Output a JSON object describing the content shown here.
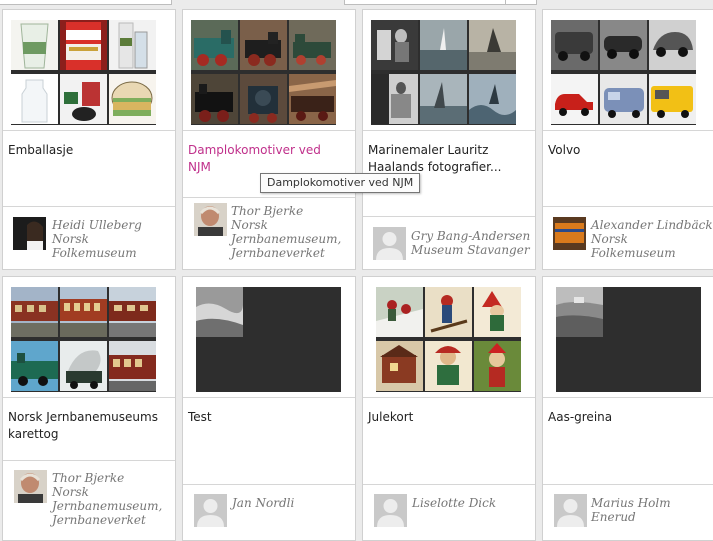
{
  "cards": [
    {
      "title": "Emballasje",
      "author_lines": [
        "Heidi Ulleberg",
        "Norsk",
        "Folkemuseum"
      ],
      "avatar": "person-dark-avatar",
      "title_is_link": false
    },
    {
      "title": "Damplokomotiver ved NJM",
      "author_lines": [
        "Thor Bjerke",
        "Norsk",
        "Jernbanemuseum,",
        "Jernbaneverket"
      ],
      "avatar": "person-portrait-avatar",
      "title_is_link": true
    },
    {
      "title": "Marinemaler Lauritz Haalands fotografier...",
      "author_lines": [
        "Gry Bang-Andersen",
        "Museum Stavanger"
      ],
      "avatar": "default-user-avatar",
      "title_is_link": false
    },
    {
      "title": "Volvo",
      "author_lines": [
        "Alexander Lindbäck",
        "Norsk",
        "Folkemuseum"
      ],
      "avatar": "orange-object-avatar",
      "title_is_link": false
    },
    {
      "title": "Norsk Jernbanemuseums karettog",
      "author_lines": [
        "Thor Bjerke",
        "Norsk",
        "Jernbanemuseum,",
        "Jernbaneverket"
      ],
      "avatar": "person-portrait-avatar",
      "title_is_link": false
    },
    {
      "title": "Test",
      "author_lines": [
        "Jan Nordli"
      ],
      "avatar": "default-user-avatar",
      "title_is_link": false
    },
    {
      "title": "Julekort",
      "author_lines": [
        "Liselotte Dick"
      ],
      "avatar": "default-user-avatar",
      "title_is_link": false
    },
    {
      "title": "Aas-greina",
      "author_lines": [
        "Marius Holm",
        "Enerud"
      ],
      "avatar": "default-user-avatar",
      "title_is_link": false
    }
  ],
  "tooltip": "Damplokomotiver ved NJM",
  "colors": {
    "link": "#c0308b",
    "text": "#222222",
    "author": "#767676",
    "thumb_bg": "#2e2e2e",
    "page_bg": "#ebebeb"
  }
}
